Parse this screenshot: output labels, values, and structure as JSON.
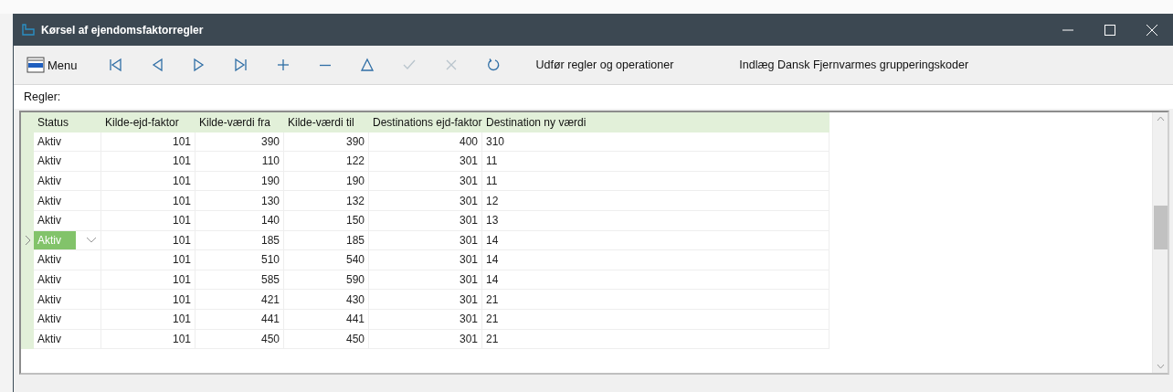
{
  "window": {
    "title": "Kørsel af ejendomsfaktorregler"
  },
  "toolbar": {
    "menu": "Menu",
    "buttons": [
      {
        "kind": "first",
        "disabled": false
      },
      {
        "kind": "prev",
        "disabled": false
      },
      {
        "kind": "next",
        "disabled": false
      },
      {
        "kind": "last",
        "disabled": false
      },
      {
        "kind": "add",
        "disabled": false
      },
      {
        "kind": "remove",
        "disabled": false
      },
      {
        "kind": "edit",
        "disabled": false
      },
      {
        "kind": "confirm",
        "disabled": true
      },
      {
        "kind": "cancel",
        "disabled": true
      },
      {
        "kind": "refresh",
        "disabled": false
      }
    ],
    "actions": [
      "Udfør regler og operationer",
      "Indlæg Dansk Fjernvarmes grupperingskoder"
    ]
  },
  "section_label": "Regler:",
  "table": {
    "columns": [
      "Status",
      "Kilde-ejd-faktor",
      "Kilde-værdi fra",
      "Kilde-værdi til",
      "Destinations ejd-faktor",
      "Destination ny værdi"
    ],
    "rows": [
      {
        "selected": false,
        "cells": [
          "Aktiv",
          "101",
          "390",
          "390",
          "400",
          "310"
        ]
      },
      {
        "selected": false,
        "cells": [
          "Aktiv",
          "101",
          "110",
          "122",
          "301",
          "11"
        ]
      },
      {
        "selected": false,
        "cells": [
          "Aktiv",
          "101",
          "190",
          "190",
          "301",
          "11"
        ]
      },
      {
        "selected": false,
        "cells": [
          "Aktiv",
          "101",
          "130",
          "132",
          "301",
          "12"
        ]
      },
      {
        "selected": false,
        "cells": [
          "Aktiv",
          "101",
          "140",
          "150",
          "301",
          "13"
        ]
      },
      {
        "selected": true,
        "cells": [
          "Aktiv",
          "101",
          "185",
          "185",
          "301",
          "14"
        ]
      },
      {
        "selected": false,
        "cells": [
          "Aktiv",
          "101",
          "510",
          "540",
          "301",
          "14"
        ]
      },
      {
        "selected": false,
        "cells": [
          "Aktiv",
          "101",
          "585",
          "590",
          "301",
          "14"
        ]
      },
      {
        "selected": false,
        "cells": [
          "Aktiv",
          "101",
          "421",
          "430",
          "301",
          "21"
        ]
      },
      {
        "selected": false,
        "cells": [
          "Aktiv",
          "101",
          "441",
          "441",
          "301",
          "21"
        ]
      },
      {
        "selected": false,
        "cells": [
          "Aktiv",
          "101",
          "450",
          "450",
          "301",
          "21"
        ]
      }
    ]
  }
}
